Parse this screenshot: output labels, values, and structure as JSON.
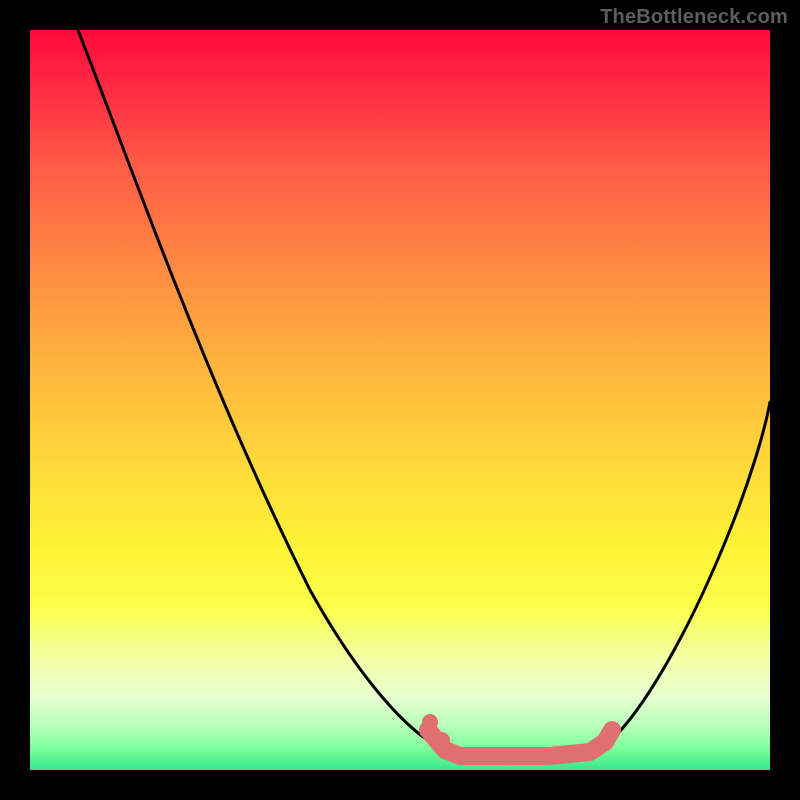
{
  "watermark": "TheBottleneck.com",
  "colors": {
    "background": "#000000",
    "gradient_top": "#ff0a3a",
    "gradient_bottom": "#36e88a",
    "curve": "#000000",
    "highlight": "#e07070",
    "watermark_text": "#5e5e5e"
  },
  "chart_data": {
    "type": "line",
    "title": "",
    "xlabel": "",
    "ylabel": "",
    "x_range": [
      0,
      100
    ],
    "y_range": [
      0,
      100
    ],
    "grid": false,
    "legend": false,
    "series": [
      {
        "name": "left_curve",
        "x": [
          6,
          15,
          24,
          38,
          45,
          51,
          56
        ],
        "y": [
          100,
          78,
          51,
          24,
          14,
          5,
          3
        ]
      },
      {
        "name": "right_curve",
        "x": [
          77,
          82,
          89,
          95,
          100
        ],
        "y": [
          3,
          7,
          19,
          32,
          50
        ]
      },
      {
        "name": "valley_highlight",
        "x": [
          54,
          56,
          58,
          70,
          76,
          78,
          79
        ],
        "y": [
          5,
          3,
          2,
          2,
          2,
          4,
          5
        ]
      },
      {
        "name": "marker_dots",
        "x": [
          54,
          56
        ],
        "y": [
          6,
          4
        ]
      }
    ],
    "background_gradient": {
      "orientation": "vertical",
      "stops": [
        {
          "pos": 0.0,
          "color": "#ff0a3a"
        },
        {
          "pos": 0.32,
          "color": "#ff8a42"
        },
        {
          "pos": 0.58,
          "color": "#ffd73a"
        },
        {
          "pos": 0.78,
          "color": "#fbff4a"
        },
        {
          "pos": 0.94,
          "color": "#b9ffb9"
        },
        {
          "pos": 1.0,
          "color": "#36e88a"
        }
      ]
    }
  }
}
